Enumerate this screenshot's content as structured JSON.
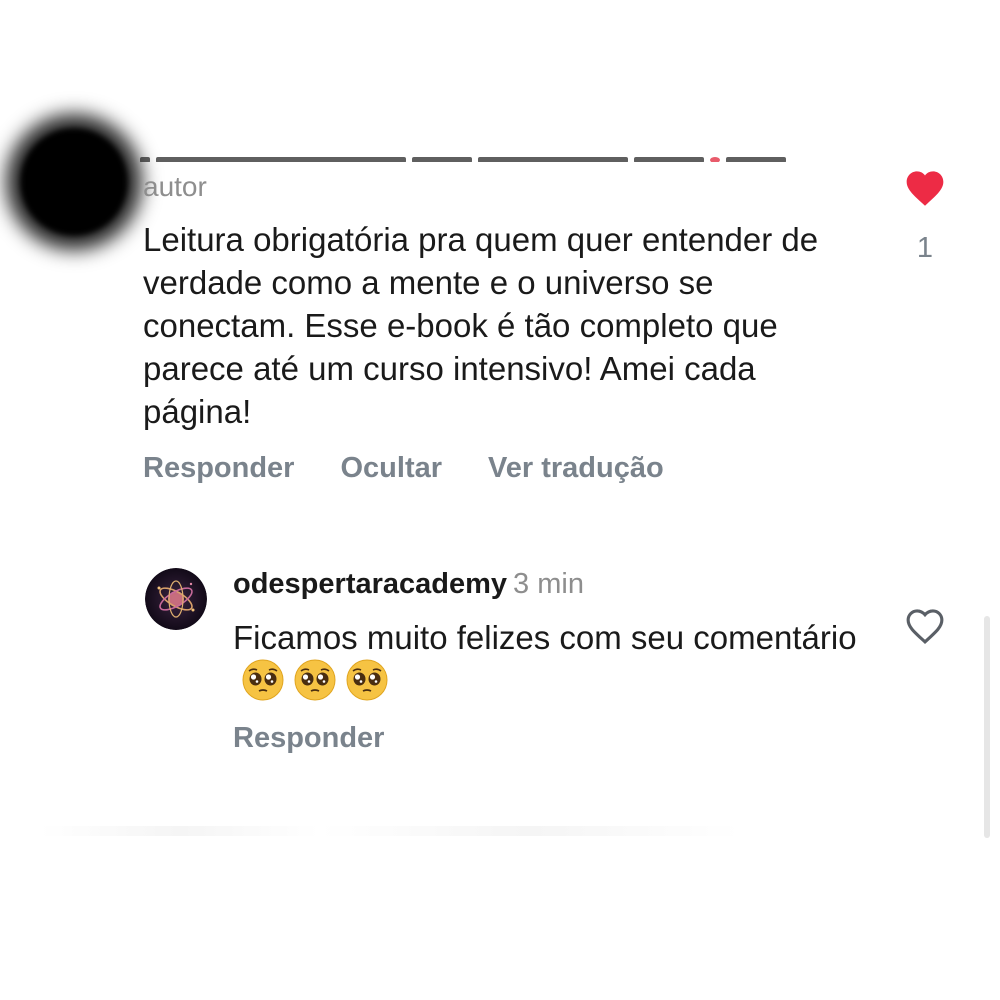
{
  "first_comment": {
    "meta": "autor",
    "text": "Leitura obrigatória pra quem quer entender de verdade como a mente e o universo se conectam. Esse e-book é tão completo que parece até um curso intensivo! Amei cada página!",
    "actions": {
      "reply": "Responder",
      "hide": "Ocultar",
      "translate": "Ver tradução"
    },
    "like_count": "1",
    "liked": true
  },
  "reply": {
    "username": "odespertaracademy",
    "time": "3 min",
    "text": "Ficamos muito felizes com seu comentário",
    "emojis": [
      "pleading-face-emoji",
      "pleading-face-emoji",
      "pleading-face-emoji"
    ],
    "actions": {
      "reply": "Responder"
    },
    "liked": false
  },
  "colors": {
    "like_red": "#ed2b45",
    "muted_text": "#7a838c",
    "meta_text": "#8e8e8e",
    "body_text": "#1a1a1a"
  }
}
